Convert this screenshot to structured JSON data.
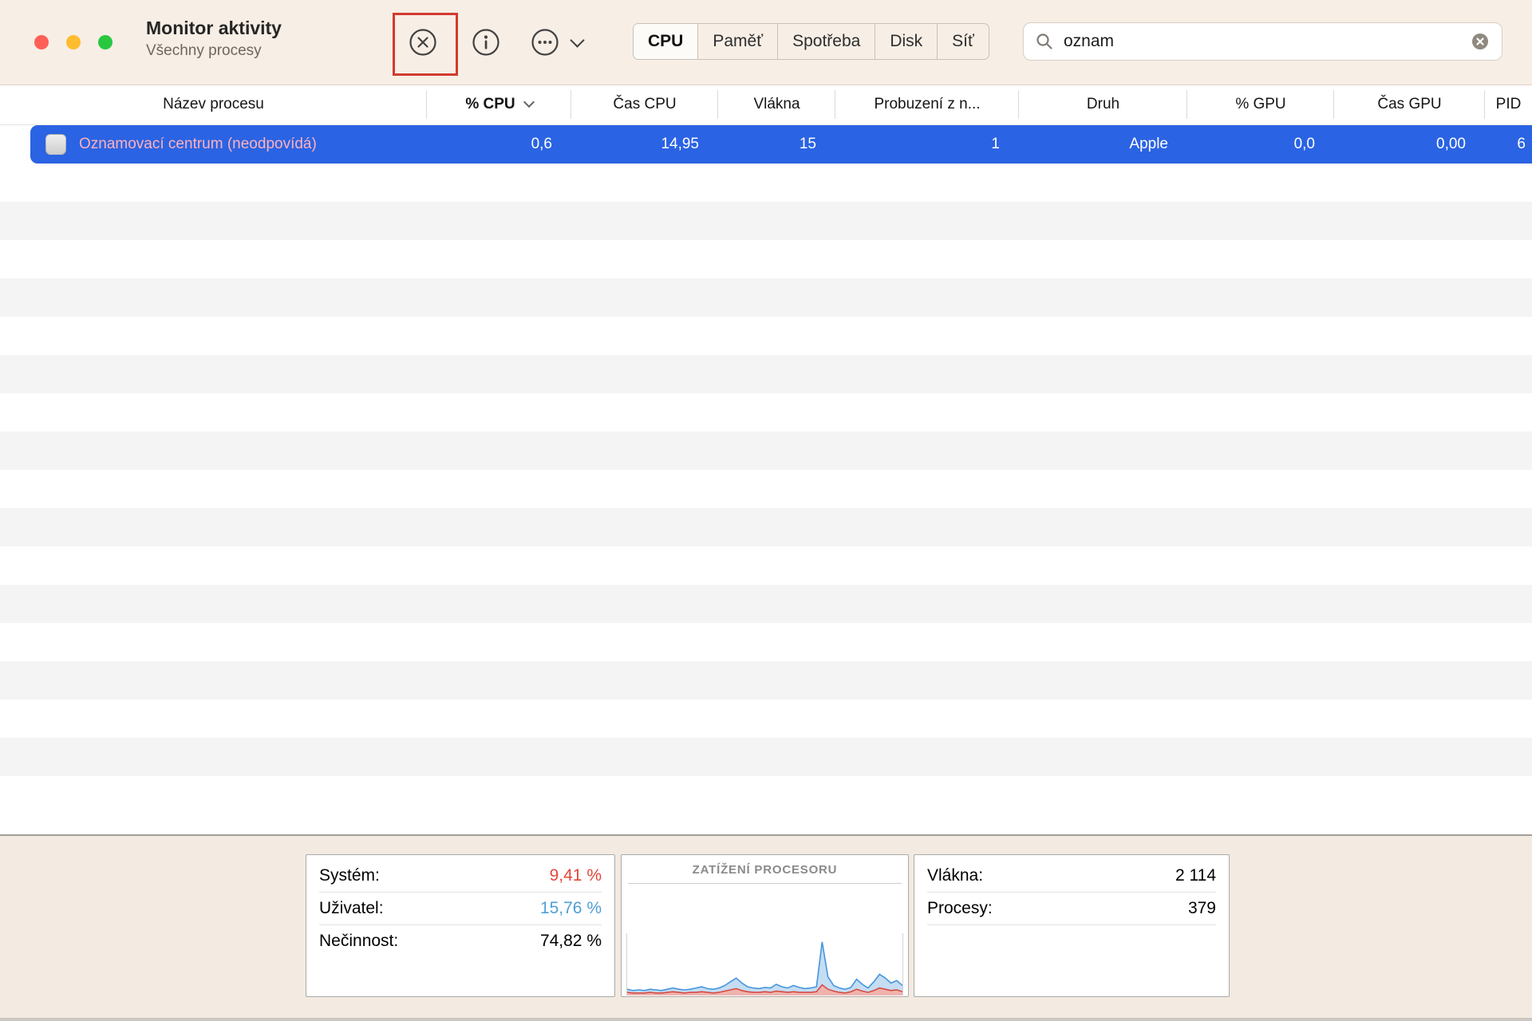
{
  "window": {
    "title": "Monitor aktivity",
    "subtitle": "Všechny procesy"
  },
  "colors": {
    "selection": "#2a63e3",
    "unresponsive_name": "#ffb1bc",
    "annotation": "#d23a2e",
    "system_value": "#e2473b",
    "user_value": "#4f9ed7",
    "toolbar_bg": "#f7eee5",
    "footer_bg": "#f3eae1"
  },
  "icons": {
    "stop": "circle-x",
    "info": "circle-i",
    "more": "circle-ellipsis",
    "disclosure": "chevron-down",
    "search": "magnifier",
    "clear": "circle-x-filled",
    "sort": "chevron-down"
  },
  "toolbar": {
    "tabs": [
      {
        "key": "cpu",
        "label": "CPU",
        "selected": true
      },
      {
        "key": "pamet",
        "label": "Paměť",
        "selected": false
      },
      {
        "key": "spotreba",
        "label": "Spotřeba",
        "selected": false
      },
      {
        "key": "disk",
        "label": "Disk",
        "selected": false
      },
      {
        "key": "sit",
        "label": "Síť",
        "selected": false
      }
    ],
    "search": {
      "value": "oznam",
      "placeholder": ""
    }
  },
  "table": {
    "columns": [
      {
        "key": "name",
        "label": "Název procesu",
        "sorted": false
      },
      {
        "key": "cpu",
        "label": "% CPU",
        "sorted": true,
        "sort_indicator": "down"
      },
      {
        "key": "cpu_time",
        "label": "Čas CPU",
        "sorted": false
      },
      {
        "key": "threads",
        "label": "Vlákna",
        "sorted": false
      },
      {
        "key": "idle_wakeups",
        "label": "Probuzení z n...",
        "sorted": false
      },
      {
        "key": "kind",
        "label": "Druh",
        "sorted": false
      },
      {
        "key": "gpu",
        "label": "% GPU",
        "sorted": false
      },
      {
        "key": "gpu_time",
        "label": "Čas GPU",
        "sorted": false
      },
      {
        "key": "pid",
        "label": "PID",
        "sorted": false
      }
    ],
    "rows": [
      {
        "name": "Oznamovací centrum (neodpovídá)",
        "cpu": "0,6",
        "cpu_time": "14,95",
        "threads": "15",
        "idle_wakeups": "1",
        "kind": "Apple",
        "gpu": "0,0",
        "gpu_time": "0,00",
        "pid": "6",
        "selected": true,
        "unresponsive": true
      }
    ],
    "empty_row_count": 17
  },
  "footer": {
    "left_stats": [
      {
        "key": "system",
        "label": "Systém:",
        "value": "9,41 %",
        "color": "#e2473b",
        "underline": true
      },
      {
        "key": "user",
        "label": "Uživatel:",
        "value": "15,76 %",
        "color": "#4f9ed7",
        "underline": true
      },
      {
        "key": "idle",
        "label": "Nečinnost:",
        "value": "74,82 %",
        "underline": false
      }
    ],
    "chart": {
      "title": "ZATÍŽENÍ PROCESORU"
    },
    "right_stats": [
      {
        "key": "threads",
        "label": "Vlákna:",
        "value": "2 114",
        "underline": true
      },
      {
        "key": "processes",
        "label": "Procesy:",
        "value": "379",
        "underline": true
      }
    ]
  },
  "chart_data": {
    "type": "area",
    "title": "ZATÍŽENÍ PROCESORU",
    "ylim": [
      0,
      100
    ],
    "series": [
      {
        "name": "total-cpu-load",
        "color": "#4695dd",
        "fill": "#c4ddf3",
        "values": [
          10,
          8,
          9,
          8,
          10,
          9,
          8,
          10,
          12,
          10,
          9,
          10,
          12,
          14,
          11,
          10,
          12,
          16,
          22,
          28,
          20,
          14,
          12,
          11,
          13,
          12,
          18,
          14,
          12,
          16,
          13,
          11,
          12,
          14,
          86,
          30,
          16,
          12,
          10,
          13,
          26,
          18,
          12,
          22,
          34,
          28,
          20,
          24,
          16
        ]
      },
      {
        "name": "system-cpu-load",
        "color": "#d64a41",
        "fill": "#efb3ae",
        "values": [
          5,
          4,
          4,
          4,
          5,
          4,
          4,
          5,
          6,
          5,
          4,
          5,
          5,
          6,
          5,
          4,
          5,
          7,
          9,
          11,
          8,
          6,
          5,
          5,
          6,
          5,
          7,
          6,
          5,
          6,
          5,
          5,
          5,
          6,
          17,
          10,
          7,
          5,
          4,
          6,
          10,
          7,
          5,
          8,
          12,
          10,
          8,
          9,
          6
        ]
      }
    ]
  }
}
